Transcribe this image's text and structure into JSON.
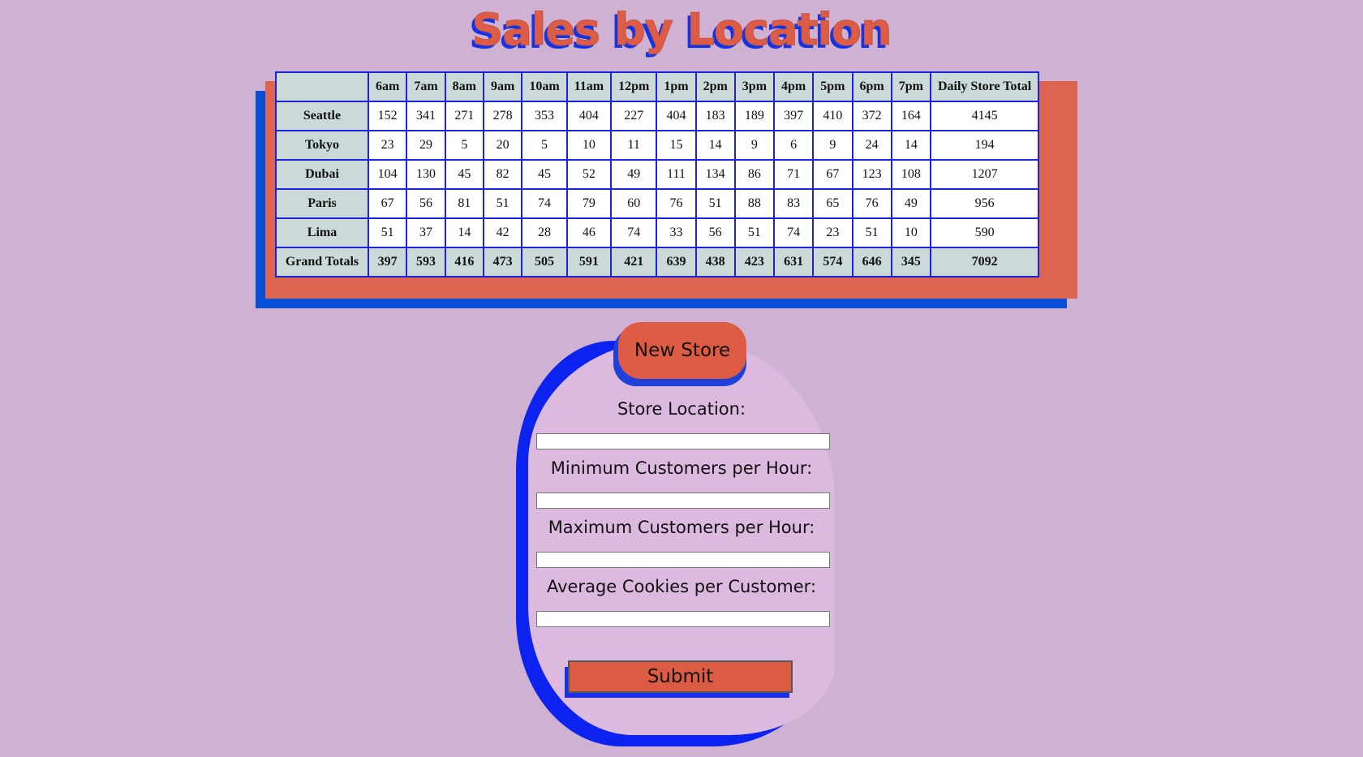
{
  "page": {
    "title": "Sales by Location"
  },
  "table": {
    "corner": "",
    "hours": [
      "6am",
      "7am",
      "8am",
      "9am",
      "10am",
      "11am",
      "12pm",
      "1pm",
      "2pm",
      "3pm",
      "4pm",
      "5pm",
      "6pm",
      "7pm"
    ],
    "total_header": "Daily Store Total",
    "rows": [
      {
        "name": "Seattle",
        "values": [
          "152",
          "341",
          "271",
          "278",
          "353",
          "404",
          "227",
          "404",
          "183",
          "189",
          "397",
          "410",
          "372",
          "164"
        ],
        "total": "4145"
      },
      {
        "name": "Tokyo",
        "values": [
          "23",
          "29",
          "5",
          "20",
          "5",
          "10",
          "11",
          "15",
          "14",
          "9",
          "6",
          "9",
          "24",
          "14"
        ],
        "total": "194"
      },
      {
        "name": "Dubai",
        "values": [
          "104",
          "130",
          "45",
          "82",
          "45",
          "52",
          "49",
          "111",
          "134",
          "86",
          "71",
          "67",
          "123",
          "108"
        ],
        "total": "1207"
      },
      {
        "name": "Paris",
        "values": [
          "67",
          "56",
          "81",
          "51",
          "74",
          "79",
          "60",
          "76",
          "51",
          "88",
          "83",
          "65",
          "76",
          "49"
        ],
        "total": "956"
      },
      {
        "name": "Lima",
        "values": [
          "51",
          "37",
          "14",
          "42",
          "28",
          "46",
          "74",
          "33",
          "56",
          "51",
          "74",
          "23",
          "51",
          "10"
        ],
        "total": "590"
      }
    ],
    "totals": {
      "name": "Grand Totals",
      "values": [
        "397",
        "593",
        "416",
        "473",
        "505",
        "591",
        "421",
        "639",
        "438",
        "423",
        "631",
        "574",
        "646",
        "345"
      ],
      "total": "7092"
    }
  },
  "form": {
    "legend": "New Store",
    "fields": [
      {
        "label": "Store Location:",
        "value": ""
      },
      {
        "label": "Minimum Customers per Hour:",
        "value": ""
      },
      {
        "label": "Maximum Customers per Hour:",
        "value": ""
      },
      {
        "label": "Average Cookies per Customer:",
        "value": ""
      }
    ],
    "submit_label": "Submit"
  },
  "colors": {
    "background": "#cfb1d3",
    "title_front": "#dd5c45",
    "title_shadow": "#1334e6",
    "table_border": "#1a24e0",
    "header_cell": "#cbd9d8",
    "button": "#dd5b42"
  }
}
